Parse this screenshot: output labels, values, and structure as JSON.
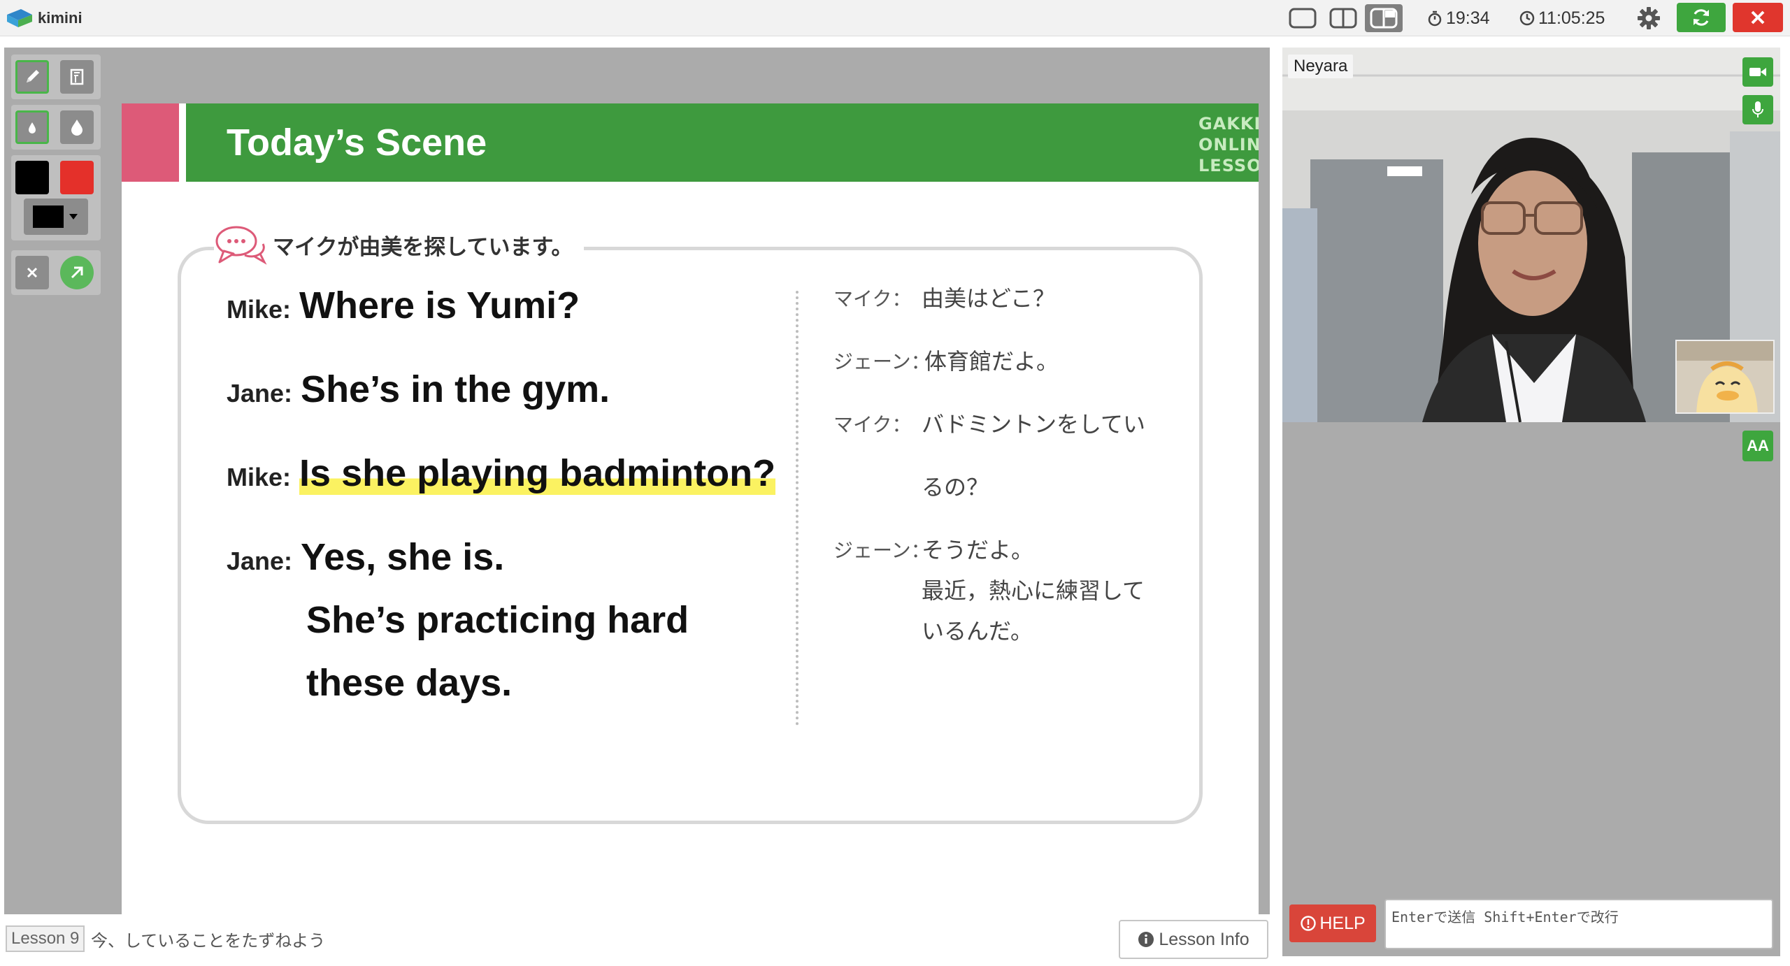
{
  "app": {
    "logo_text": "kimini"
  },
  "topbar": {
    "timer": "19:34",
    "clock": "11:05:25"
  },
  "slide": {
    "title": "Today’s Scene",
    "brand_lines": [
      "GAKKEN",
      "ONLINE",
      "LESSONS"
    ],
    "box_header": "マイクが由美を探しています。",
    "english": [
      {
        "speaker": "Mike:",
        "text": "Where is Yumi?"
      },
      {
        "speaker": "Jane:",
        "text": "She’s in the gym."
      },
      {
        "speaker": "Mike:",
        "text": "Is she playing badminton?"
      },
      {
        "speaker": "Jane:",
        "text": "Yes, she is."
      }
    ],
    "english_continued": [
      "She’s practicing hard",
      "these days."
    ],
    "japanese": [
      {
        "speaker": "マイク：",
        "lines": [
          "由美はどこ？"
        ]
      },
      {
        "speaker": "ジェーン：",
        "lines": [
          "体育館だよ。"
        ]
      },
      {
        "speaker": "マイク：",
        "lines": [
          "バドミントンをしてい",
          "るの？"
        ]
      },
      {
        "speaker": "ジェーン：",
        "lines": [
          "そうだよ。",
          "最近，熱心に練習して",
          "いるんだ。"
        ]
      }
    ]
  },
  "footer": {
    "lesson_number": "Lesson 9",
    "lesson_title": "今、していることをたずねよう",
    "lesson_info_label": "Lesson Info"
  },
  "video": {
    "participant_name": "Neyara",
    "font_button_label": "AA"
  },
  "chat": {
    "help_label": "HELP",
    "input_placeholder": "Enterで送信 Shift+Enterで改行",
    "input_value": ""
  },
  "colors": {
    "accent_green": "#3ea63e",
    "danger_red": "#e0362d",
    "slide_header_green": "#3e9a3e",
    "slide_pink": "#dd5a78",
    "highlight_yellow": "#fbf261"
  }
}
